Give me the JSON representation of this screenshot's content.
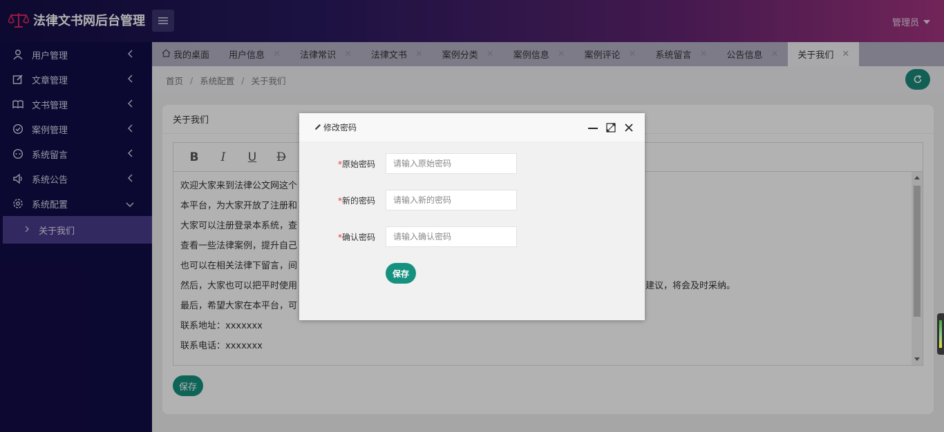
{
  "app": {
    "title": "法律文书网后台管理",
    "user": "管理员"
  },
  "sidebar": {
    "items": [
      {
        "label": "用户管理",
        "icon": "user-icon"
      },
      {
        "label": "文章管理",
        "icon": "edit-icon"
      },
      {
        "label": "文书管理",
        "icon": "book-icon"
      },
      {
        "label": "案例管理",
        "icon": "check-circle-icon"
      },
      {
        "label": "系统留言",
        "icon": "message-icon"
      },
      {
        "label": "系统公告",
        "icon": "speaker-icon"
      },
      {
        "label": "系统配置",
        "icon": "gear-icon"
      }
    ],
    "sub_item": "关于我们"
  },
  "tabs": [
    {
      "label": "我的桌面"
    },
    {
      "label": "用户信息"
    },
    {
      "label": "法律常识"
    },
    {
      "label": "法律文书"
    },
    {
      "label": "案例分类"
    },
    {
      "label": "案例信息"
    },
    {
      "label": "案例评论"
    },
    {
      "label": "系统留言"
    },
    {
      "label": "公告信息"
    },
    {
      "label": "关于我们",
      "active": true
    }
  ],
  "breadcrumb": [
    "首页",
    "系统配置",
    "关于我们"
  ],
  "card": {
    "title": "关于我们",
    "toolbar": [
      "B",
      "I",
      "U",
      "D"
    ],
    "lines": [
      "欢迎大家来到法律公文网这个",
      "本平台，为大家开放了注册和",
      "大家可以注册登录本系统，查",
      "查看一些法律案例，提升自己",
      "也可以在相关法律下留言，间",
      "然后，大家也可以把平时使用",
      "最后，希望大家在本平台，可",
      "联系地址：xxxxxxx",
      "联系电话：xxxxxxx"
    ],
    "line6_tail": "建议，将会及时采纳。",
    "save": "保存"
  },
  "modal": {
    "title": "修改密码",
    "fields": [
      {
        "label": "原始密码",
        "placeholder": "请输入原始密码"
      },
      {
        "label": "新的密码",
        "placeholder": "请输入新的密码"
      },
      {
        "label": "确认密码",
        "placeholder": "请输入确认密码"
      }
    ],
    "save": "保存"
  },
  "colors": {
    "accent": "#16907f",
    "sidebar": "#110c48",
    "header_start": "#130e45",
    "header_end": "#a3347f"
  }
}
